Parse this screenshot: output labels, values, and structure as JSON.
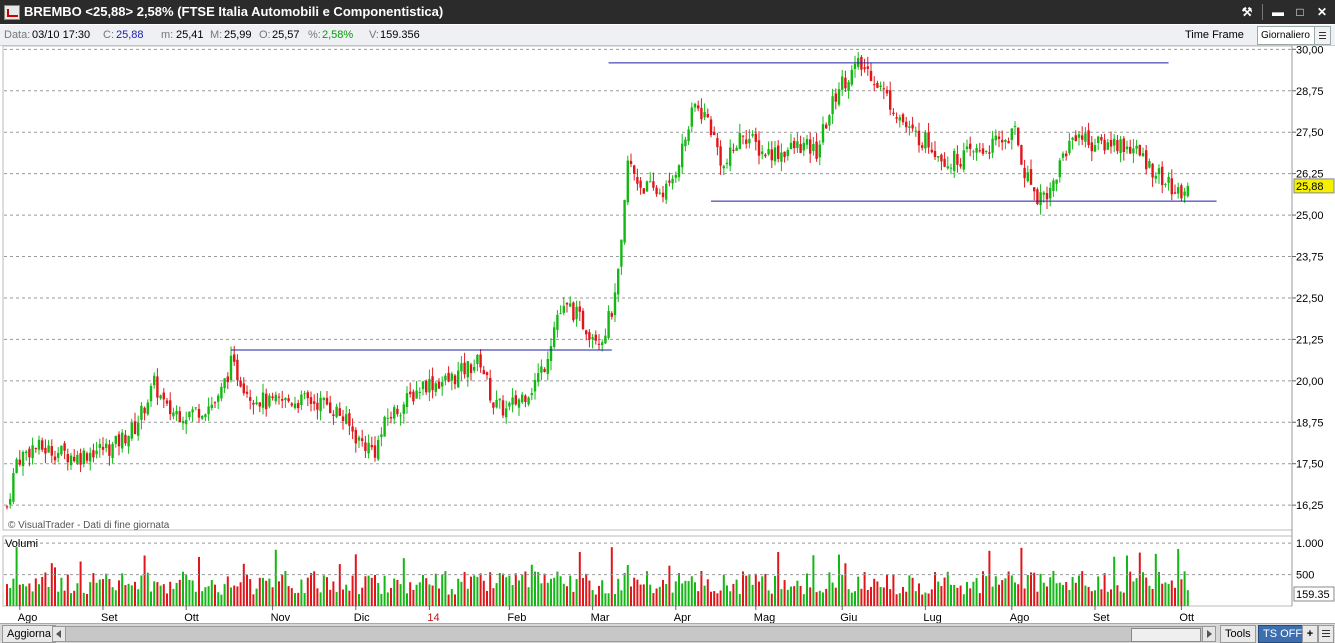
{
  "window": {
    "title": "BREMBO <25,88> 2,58%  (FTSE Italia Automobili e Componentistica)",
    "buttons": {
      "tools": "⚒",
      "minimize": "▬",
      "maximize": "□",
      "close": "✕"
    }
  },
  "infobar": {
    "date_label": "Data:",
    "date_value": "03/10 17:30",
    "close_label": "C:",
    "close_value": "25,88",
    "min_label": "m:",
    "min_value": "25,41",
    "max_label": "M:",
    "max_value": "25,99",
    "open_label": "O:",
    "open_value": "25,57",
    "pct_label": "%:",
    "pct_value": "2,58%",
    "vol_label": "V:",
    "vol_value": "159.356",
    "timeframe_label": "Time Frame",
    "timeframe_value": "Giornaliero"
  },
  "chart_data": [
    {
      "type": "candlestick",
      "ylim": [
        15.5,
        30.1
      ],
      "y_ticks": [
        "30,00",
        "28,75",
        "27,50",
        "26,25",
        "25,00",
        "23,75",
        "22,50",
        "21,25",
        "20,00",
        "18,75",
        "17,50",
        "16,25"
      ],
      "y_tick_values": [
        30.0,
        28.75,
        27.5,
        26.25,
        25.0,
        23.75,
        22.5,
        21.25,
        20.0,
        18.75,
        17.5,
        16.25
      ],
      "last_price_label": "25,88",
      "last_price": 25.88,
      "grid": true,
      "watermark": "© VisualTrader - Dati di fine giornata",
      "x_labels": [
        "Ago",
        "Set",
        "Ott",
        "Nov",
        "Dic",
        "14",
        "Feb",
        "Mar",
        "Apr",
        "Mag",
        "Giu",
        "Lug",
        "Ago",
        "Set",
        "Ott"
      ],
      "x_label_days": [
        4,
        30,
        56,
        83,
        109,
        132,
        157,
        183,
        209,
        234,
        261,
        287,
        314,
        340,
        367
      ],
      "guide_lines": [
        {
          "y": 20.93,
          "day_start": 70,
          "day_end": 189
        },
        {
          "y": 29.59,
          "day_start": 188,
          "day_end": 363
        },
        {
          "y": 25.42,
          "day_start": 220,
          "day_end": 378
        }
      ],
      "colors": {
        "up": "#14b814",
        "down": "#e0161b",
        "guide": "#1c1ca6"
      }
    },
    {
      "type": "bar",
      "title": "Volumi",
      "y_ticks": [
        "1.000",
        "500"
      ],
      "y_tick_values": [
        1000,
        500
      ],
      "last_volume_label": "159.35",
      "last_volume": 159.356
    }
  ],
  "footer": {
    "refresh_label": "Aggiorna",
    "tools_label": "Tools",
    "ts_label": "TS OFF",
    "plus_label": "+"
  }
}
